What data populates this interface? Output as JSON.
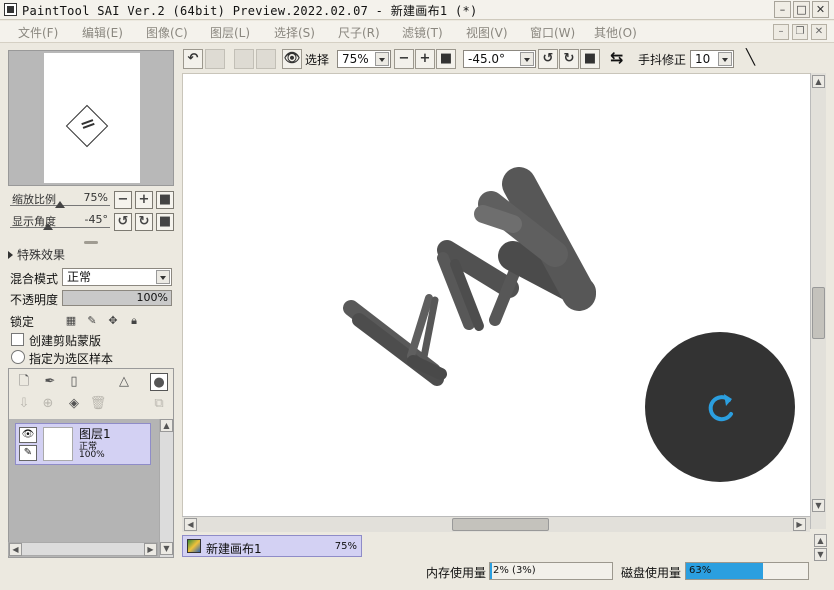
{
  "window": {
    "title": "PaintTool SAI Ver.2 (64bit) Preview.2022.02.07 - 新建画布1 (*)",
    "min_icon": "minimize-icon",
    "max_icon": "maximize-icon",
    "close_icon": "close-icon"
  },
  "menu": [
    "文件(F)",
    "编辑(E)",
    "图像(C)",
    "图层(L)",
    "选择(S)",
    "尺子(R)",
    "滤镜(T)",
    "视图(V)",
    "窗口(W)",
    "其他(O)"
  ],
  "navigator": {
    "zoom_label": "缩放比例",
    "zoom_value": "75%",
    "zoom_level": 0.5,
    "angle_label": "显示角度",
    "angle_value": "-45°",
    "angle_level": 0.38
  },
  "effects": {
    "label": "特殊效果"
  },
  "layer_props": {
    "blend_label": "混合模式",
    "blend_value": "正常",
    "opacity_label": "不透明度",
    "opacity_value": "100%",
    "lock_label": "锁定",
    "clipping_label": "创建剪贴蒙版",
    "selection_source_label": "指定为选区样本"
  },
  "layers": [
    {
      "name": "图层1",
      "mode": "正常",
      "opacity": "100%"
    }
  ],
  "toolbar": {
    "select_label": "选择",
    "zoom_value": "75%",
    "angle_value": "-45.0°",
    "stabilizer_label": "手抖修正",
    "stabilizer_value": "10"
  },
  "canvas_tab": {
    "name": "新建画布1",
    "zoom": "75%"
  },
  "status": {
    "memory_label": "内存使用量",
    "memory_value": "2% (3%)",
    "memory_fraction": 0.02,
    "disk_label": "磁盘使用量",
    "disk_value": "63%",
    "disk_fraction": 0.63
  },
  "colors": {
    "accent": "#2b9fe0",
    "layer_selected": "#d3d1f3",
    "loading_circle": "#333333"
  }
}
